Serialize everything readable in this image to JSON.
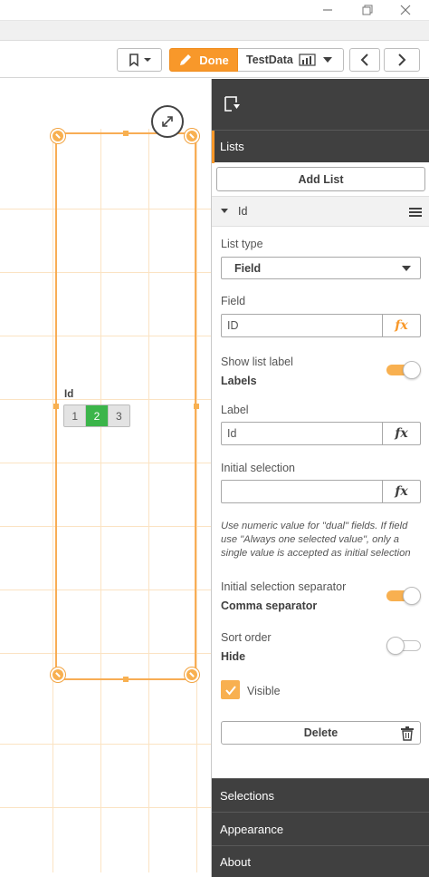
{
  "toolbar": {
    "done_label": "Done",
    "sheet_name": "TestData"
  },
  "listbox": {
    "title": "Id",
    "items": [
      "1",
      "2",
      "3"
    ],
    "selected": "2"
  },
  "panel": {
    "lists_header": "Lists",
    "add_list_label": "Add List",
    "item_title": "Id",
    "list_type_label": "List type",
    "list_type_value": "Field",
    "field_label": "Field",
    "field_value": "ID",
    "fx_label": "fx",
    "show_list_label_label": "Show list label",
    "show_list_label_value": "Labels",
    "show_list_label_on": true,
    "label_label": "Label",
    "label_value": "Id",
    "initial_selection_label": "Initial selection",
    "initial_selection_value": "",
    "hint_text": "Use numeric value for \"dual\" fields. If field use \"Always one selected value\", only a single value is accepted as initial selection",
    "separator_label": "Initial selection separator",
    "separator_value": "Comma separator",
    "separator_on": true,
    "sort_order_label": "Sort order",
    "sort_order_value": "Hide",
    "sort_order_on": false,
    "visible_label": "Visible",
    "visible_checked": true,
    "delete_label": "Delete",
    "sections": [
      "Selections",
      "Appearance",
      "About"
    ]
  },
  "colors": {
    "accent": "#f8982a",
    "selected_green": "#3bb54a",
    "panel_dark": "#404040"
  }
}
